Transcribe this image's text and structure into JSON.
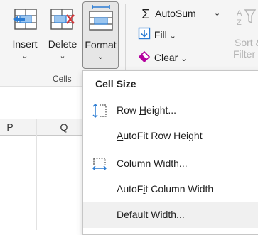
{
  "ribbon": {
    "cells_group_label": "Cells",
    "insert": {
      "label": "Insert",
      "chevron": "⌄"
    },
    "delete": {
      "label": "Delete",
      "chevron": "⌄"
    },
    "format": {
      "label": "Format",
      "chevron": "⌄"
    },
    "autosum": {
      "symbol": "Σ",
      "label": "AutoSum",
      "chevron": "⌄"
    },
    "fill": {
      "label": "Fill",
      "chevron": "⌄"
    },
    "clear": {
      "label": "Clear",
      "chevron": "⌄"
    },
    "sort_filter": {
      "line1": "Sort &",
      "line2": "Filter"
    }
  },
  "sheet": {
    "columns": [
      "P",
      "Q"
    ]
  },
  "format_menu": {
    "heading": "Cell Size",
    "items": [
      {
        "pre": "Row ",
        "key": "H",
        "post": "eight...",
        "icon": "row-height-icon"
      },
      {
        "pre": "",
        "key": "A",
        "post": "utoFit Row Height",
        "icon": ""
      },
      {
        "pre": "Column ",
        "key": "W",
        "post": "idth...",
        "icon": "column-width-icon"
      },
      {
        "pre": "AutoF",
        "key": "i",
        "post": "t Column Width",
        "icon": ""
      },
      {
        "pre": "",
        "key": "D",
        "post": "efault Width...",
        "icon": ""
      }
    ]
  },
  "colors": {
    "accent_blue": "#2b7cd3",
    "delete_red": "#d13438",
    "clear_pink": "#b4009e"
  }
}
